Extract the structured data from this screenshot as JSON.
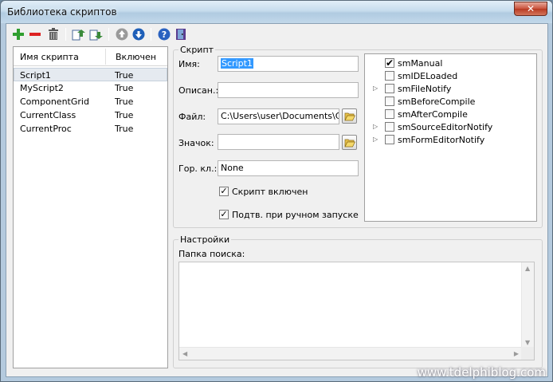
{
  "window": {
    "title": "Библиотека скриптов",
    "close_label": "✕"
  },
  "toolbar": {
    "buttons": [
      {
        "name": "add-script-button",
        "icon": "plus-icon"
      },
      {
        "name": "remove-script-button",
        "icon": "minus-icon"
      },
      {
        "name": "delete-script-button",
        "icon": "trash-icon"
      },
      {
        "name": "import-button",
        "icon": "import-icon"
      },
      {
        "name": "export-button",
        "icon": "export-icon"
      },
      {
        "name": "move-up-button",
        "icon": "arrow-up-icon"
      },
      {
        "name": "move-down-button",
        "icon": "arrow-down-icon"
      },
      {
        "name": "help-button",
        "icon": "help-icon"
      },
      {
        "name": "exit-button",
        "icon": "door-icon"
      }
    ]
  },
  "script_list": {
    "columns": [
      "Имя скрипта",
      "Включен"
    ],
    "rows": [
      {
        "name": "Script1",
        "enabled": "True",
        "selected": true
      },
      {
        "name": "MyScript2",
        "enabled": "True"
      },
      {
        "name": "ComponentGrid",
        "enabled": "True"
      },
      {
        "name": "CurrentClass",
        "enabled": "True"
      },
      {
        "name": "CurrentProc",
        "enabled": "True"
      }
    ]
  },
  "script_group": {
    "title": "Скрипт",
    "name_label": "Имя:",
    "name_value": "Script1",
    "desc_label": "Описан.:",
    "desc_value": "",
    "file_label": "Файл:",
    "file_value": "C:\\Users\\user\\Documents\\CnW",
    "icon_label": "Значок:",
    "icon_value": "",
    "hotkey_label": "Гор. кл.:",
    "hotkey_value": "None",
    "enabled_label": "Скрипт включен",
    "enabled_checked": true,
    "confirm_label": "Подтв. при ручном запуске",
    "confirm_checked": true
  },
  "events_tree": {
    "items": [
      {
        "label": "smManual",
        "checked": true,
        "expandable": false
      },
      {
        "label": "smIDELoaded",
        "checked": false,
        "expandable": false
      },
      {
        "label": "smFileNotify",
        "checked": false,
        "expandable": true
      },
      {
        "label": "smBeforeCompile",
        "checked": false,
        "expandable": false
      },
      {
        "label": "smAfterCompile",
        "checked": false,
        "expandable": false
      },
      {
        "label": "smSourceEditorNotify",
        "checked": false,
        "expandable": true
      },
      {
        "label": "smFormEditorNotify",
        "checked": false,
        "expandable": true
      }
    ]
  },
  "settings_group": {
    "title": "Настройки",
    "search_folder_label": "Папка поиска:",
    "search_folder_value": ""
  },
  "watermark": "www.tdelphiblog.com",
  "colors": {
    "accent": "#3399ff",
    "close": "#c9523c"
  }
}
